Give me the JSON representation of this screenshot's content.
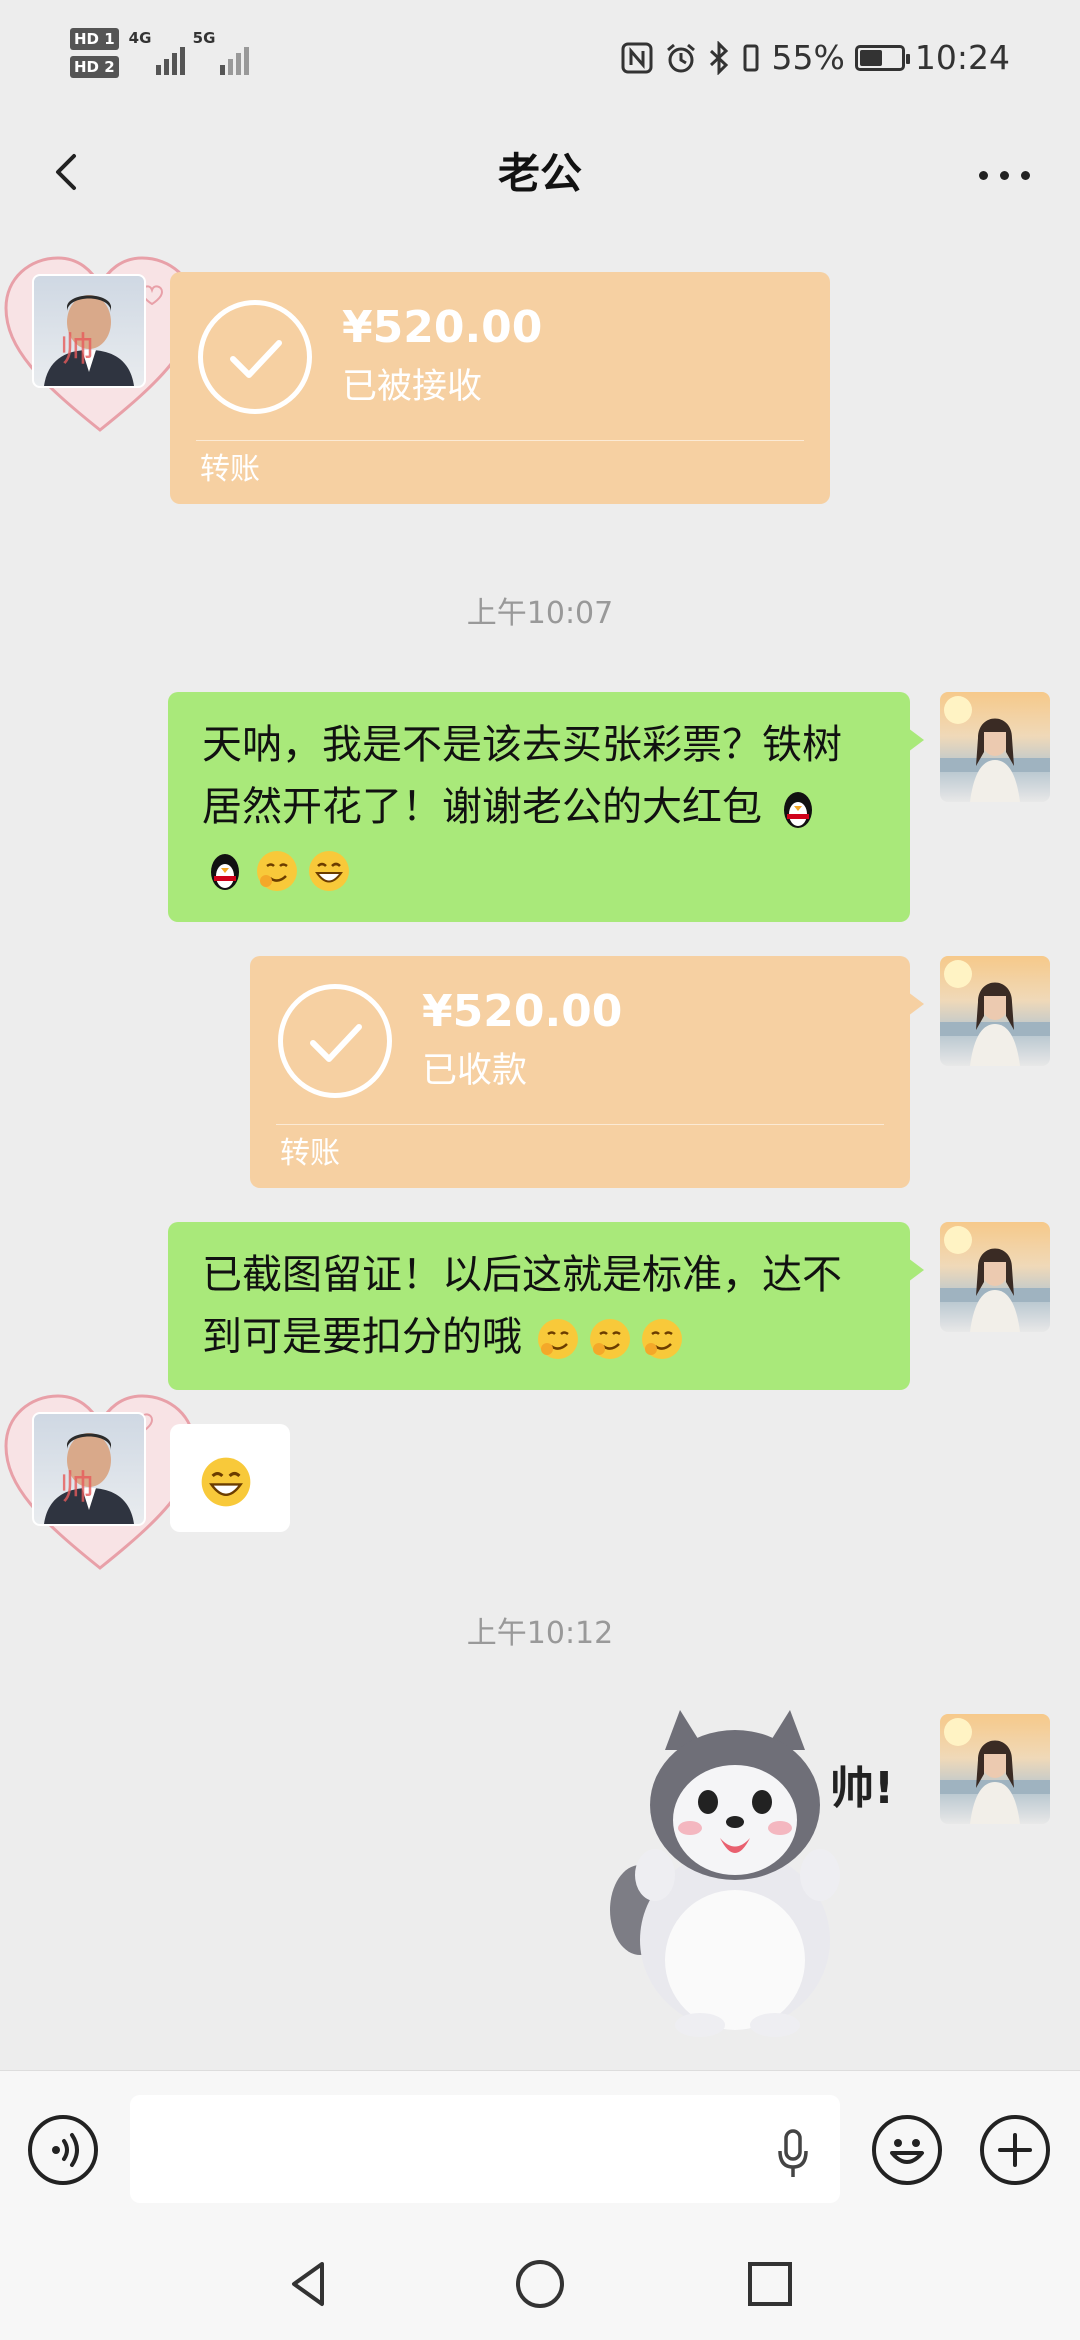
{
  "status_bar": {
    "hd1": "HD 1",
    "hd2": "HD 2",
    "net1": "4G",
    "net2": "5G",
    "battery_pct": "55%",
    "battery_level": 0.55,
    "time": "10:24"
  },
  "header": {
    "title": "老公"
  },
  "messages": {
    "m1": {
      "amount": "¥520.00",
      "status": "已被接收",
      "label": "转账"
    },
    "time1": "上午10:07",
    "m2": {
      "text": "天呐，我是不是该去买张彩票？铁树居然开花了！谢谢老公的大红包"
    },
    "m3": {
      "amount": "¥520.00",
      "status": "已收款",
      "label": "转账"
    },
    "m4": {
      "text": "已截图留证！以后这就是标准，达不到可是要扣分的哦"
    },
    "time2": "上午10:12",
    "sticker_text": "帅!"
  },
  "avatar_glyph": "帅",
  "input": {
    "placeholder": ""
  },
  "colors": {
    "green_bubble": "#a9e97a",
    "transfer_bubble": "#f6d0a2",
    "background": "#ededed"
  },
  "icons": {
    "back": "chevron-left-icon",
    "more": "more-dots-icon",
    "voice": "voice-icon",
    "mic": "mic-icon",
    "emoji": "emoji-icon",
    "plus": "plus-icon",
    "nav_back": "triangle-back-icon",
    "nav_home": "circle-home-icon",
    "nav_recent": "square-recent-icon"
  }
}
